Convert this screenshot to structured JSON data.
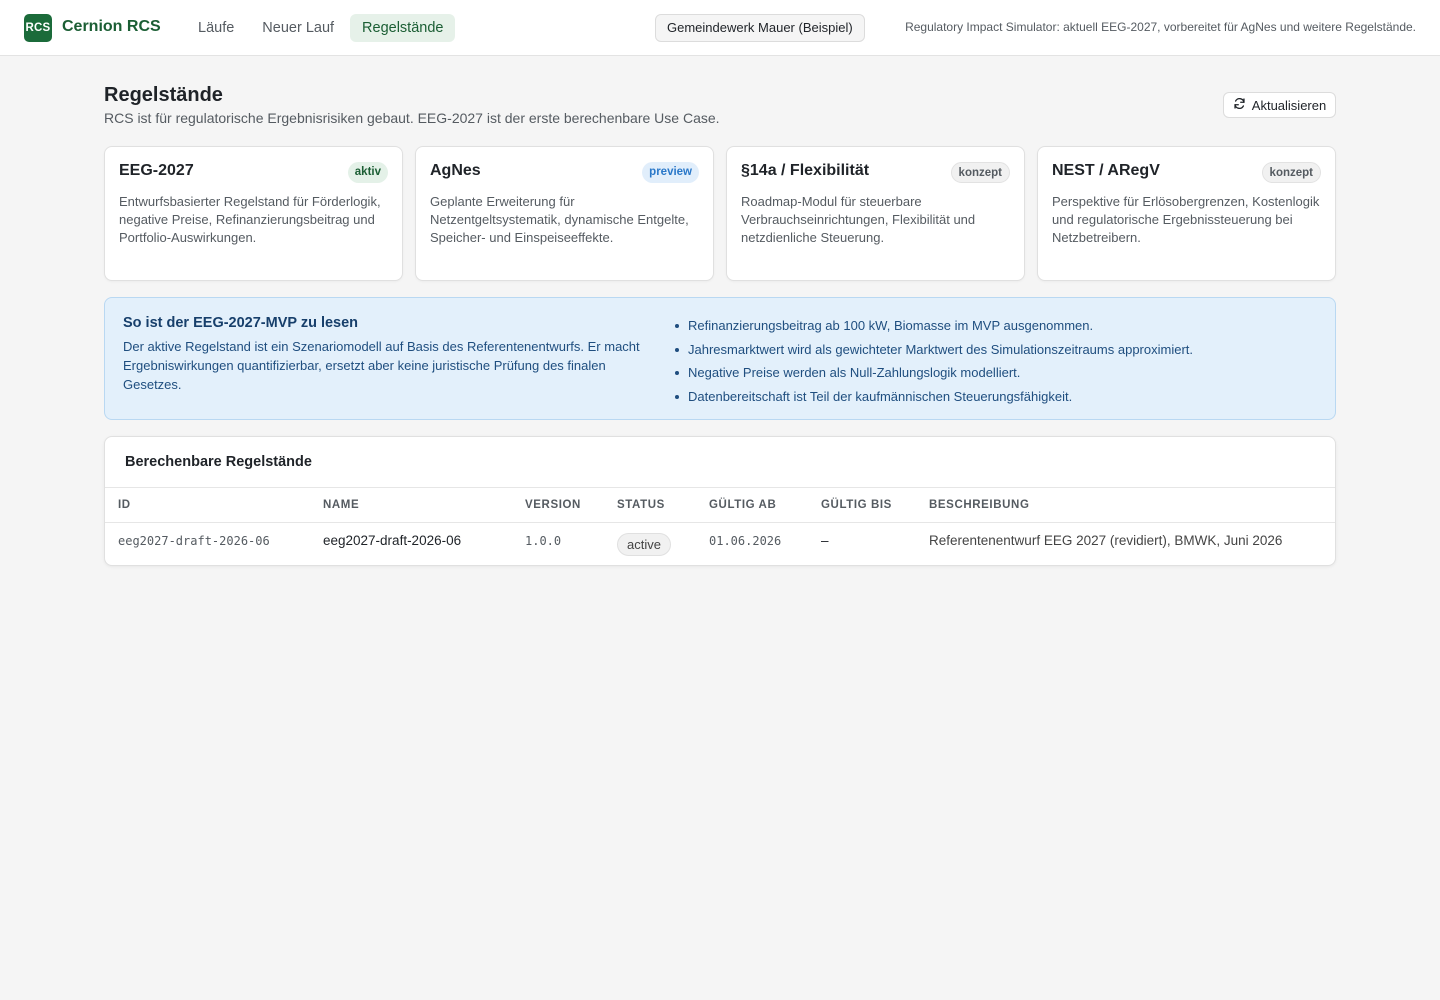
{
  "app": {
    "logo_text": "RCS",
    "brand": "Cernion RCS",
    "tenant": "Gemeindewerk Mauer (Beispiel)",
    "tagline": "Regulatory Impact Simulator: aktuell EEG-2027, vorbereitet für AgNes und weitere Regelstände.",
    "accent_color": "#1b6b3a"
  },
  "nav": {
    "items": [
      {
        "label": "Läufe",
        "active": false
      },
      {
        "label": "Neuer Lauf",
        "active": false
      },
      {
        "label": "Regelstände",
        "active": true
      }
    ]
  },
  "page": {
    "title": "Regelstände",
    "subtitle": "RCS ist für regulatorische Ergebnisrisiken gebaut. EEG-2027 ist der erste berechenbare Use Case.",
    "refresh_label": "Aktualisieren",
    "refresh_icon": "refresh-icon"
  },
  "cards": [
    {
      "title": "EEG-2027",
      "badge": "aktiv",
      "description": "Entwurfsbasierter Regelstand für Förderlogik, negative Preise, Refinanzierungsbeitrag und Portfolio-Auswirkungen."
    },
    {
      "title": "AgNes",
      "badge": "preview",
      "description": "Geplante Erweiterung für Netzentgeltsystematik, dynamische Entgelte, Speicher- und Einspeiseeffekte."
    },
    {
      "title": "§14a / Flexibilität",
      "badge": "konzept",
      "description": "Roadmap-Modul für steuerbare Verbrauchseinrichtungen, Flexibilität und netzdienliche Steuerung."
    },
    {
      "title": "NEST / ARegV",
      "badge": "konzept",
      "description": "Perspektive für Erlösobergrenzen, Kostenlogik und regulatorische Ergebnissteuerung bei Netzbetreibern."
    }
  ],
  "info": {
    "title": "So ist der EEG-2027-MVP zu lesen",
    "text": "Der aktive Regelstand ist ein Szenariomodell auf Basis des Referentenentwurfs. Er macht Ergebniswirkungen quantifizierbar, ersetzt aber keine juristische Prüfung des finalen Gesetzes.",
    "points": [
      "Refinanzierungsbeitrag ab 100 kW, Biomasse im MVP ausgenommen.",
      "Jahresmarktwert wird als gewichteter Marktwert des Simulationszeitraums approximiert.",
      "Negative Preise werden als Null-Zahlungslogik modelliert.",
      "Datenbereitschaft ist Teil der kaufmännischen Steuerungsfähigkeit."
    ]
  },
  "table": {
    "title": "Berechenbare Regelstände",
    "headers": {
      "id": "ID",
      "name": "NAME",
      "version": "VERSION",
      "status": "STATUS",
      "valid_from": "GÜLTIG AB",
      "valid_to": "GÜLTIG BIS",
      "description": "BESCHREIBUNG"
    },
    "rows": [
      {
        "id": "eeg2027-draft-2026-06",
        "name": "eeg2027-draft-2026-06",
        "version": "1.0.0",
        "status": "active",
        "valid_from": "01.06.2026",
        "valid_to": "–",
        "description": "Referentenentwurf EEG 2027 (revidiert), BMWK, Juni 2026"
      }
    ]
  }
}
